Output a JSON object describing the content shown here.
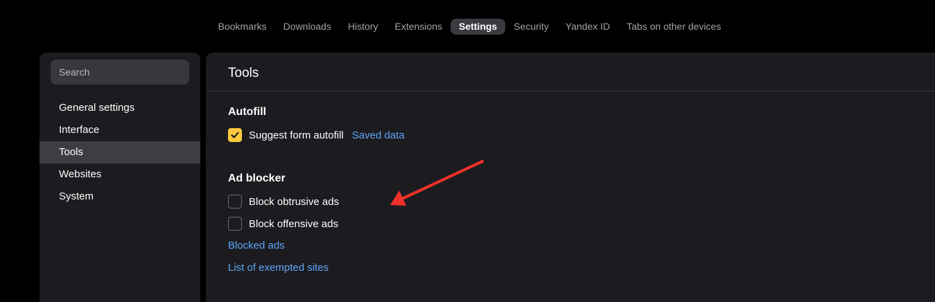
{
  "topnav": {
    "tabs": [
      {
        "label": "Bookmarks",
        "active": false
      },
      {
        "label": "Downloads",
        "active": false
      },
      {
        "label": "History",
        "active": false
      },
      {
        "label": "Extensions",
        "active": false
      },
      {
        "label": "Settings",
        "active": true
      },
      {
        "label": "Security",
        "active": false
      },
      {
        "label": "Yandex ID",
        "active": false
      },
      {
        "label": "Tabs on other devices",
        "active": false
      }
    ]
  },
  "sidebar": {
    "search_placeholder": "Search",
    "items": [
      {
        "label": "General settings"
      },
      {
        "label": "Interface"
      },
      {
        "label": "Tools",
        "active": true
      },
      {
        "label": "Websites"
      },
      {
        "label": "System"
      }
    ]
  },
  "main": {
    "title": "Tools",
    "autofill": {
      "title": "Autofill",
      "suggest_label": "Suggest form autofill",
      "suggest_checked": true,
      "saved_data_link": "Saved data"
    },
    "ad_blocker": {
      "title": "Ad blocker",
      "obtrusive_label": "Block obtrusive ads",
      "obtrusive_checked": false,
      "offensive_label": "Block offensive ads",
      "offensive_checked": false,
      "blocked_ads_link": "Blocked ads",
      "exempted_link": "List of exempted sites"
    }
  },
  "colors": {
    "accent_checkbox": "#fcca3f",
    "link": "#5ea5f7",
    "annotation_arrow": "#f2312a"
  },
  "icons": [
    "check-icon",
    "annotation-arrow"
  ]
}
